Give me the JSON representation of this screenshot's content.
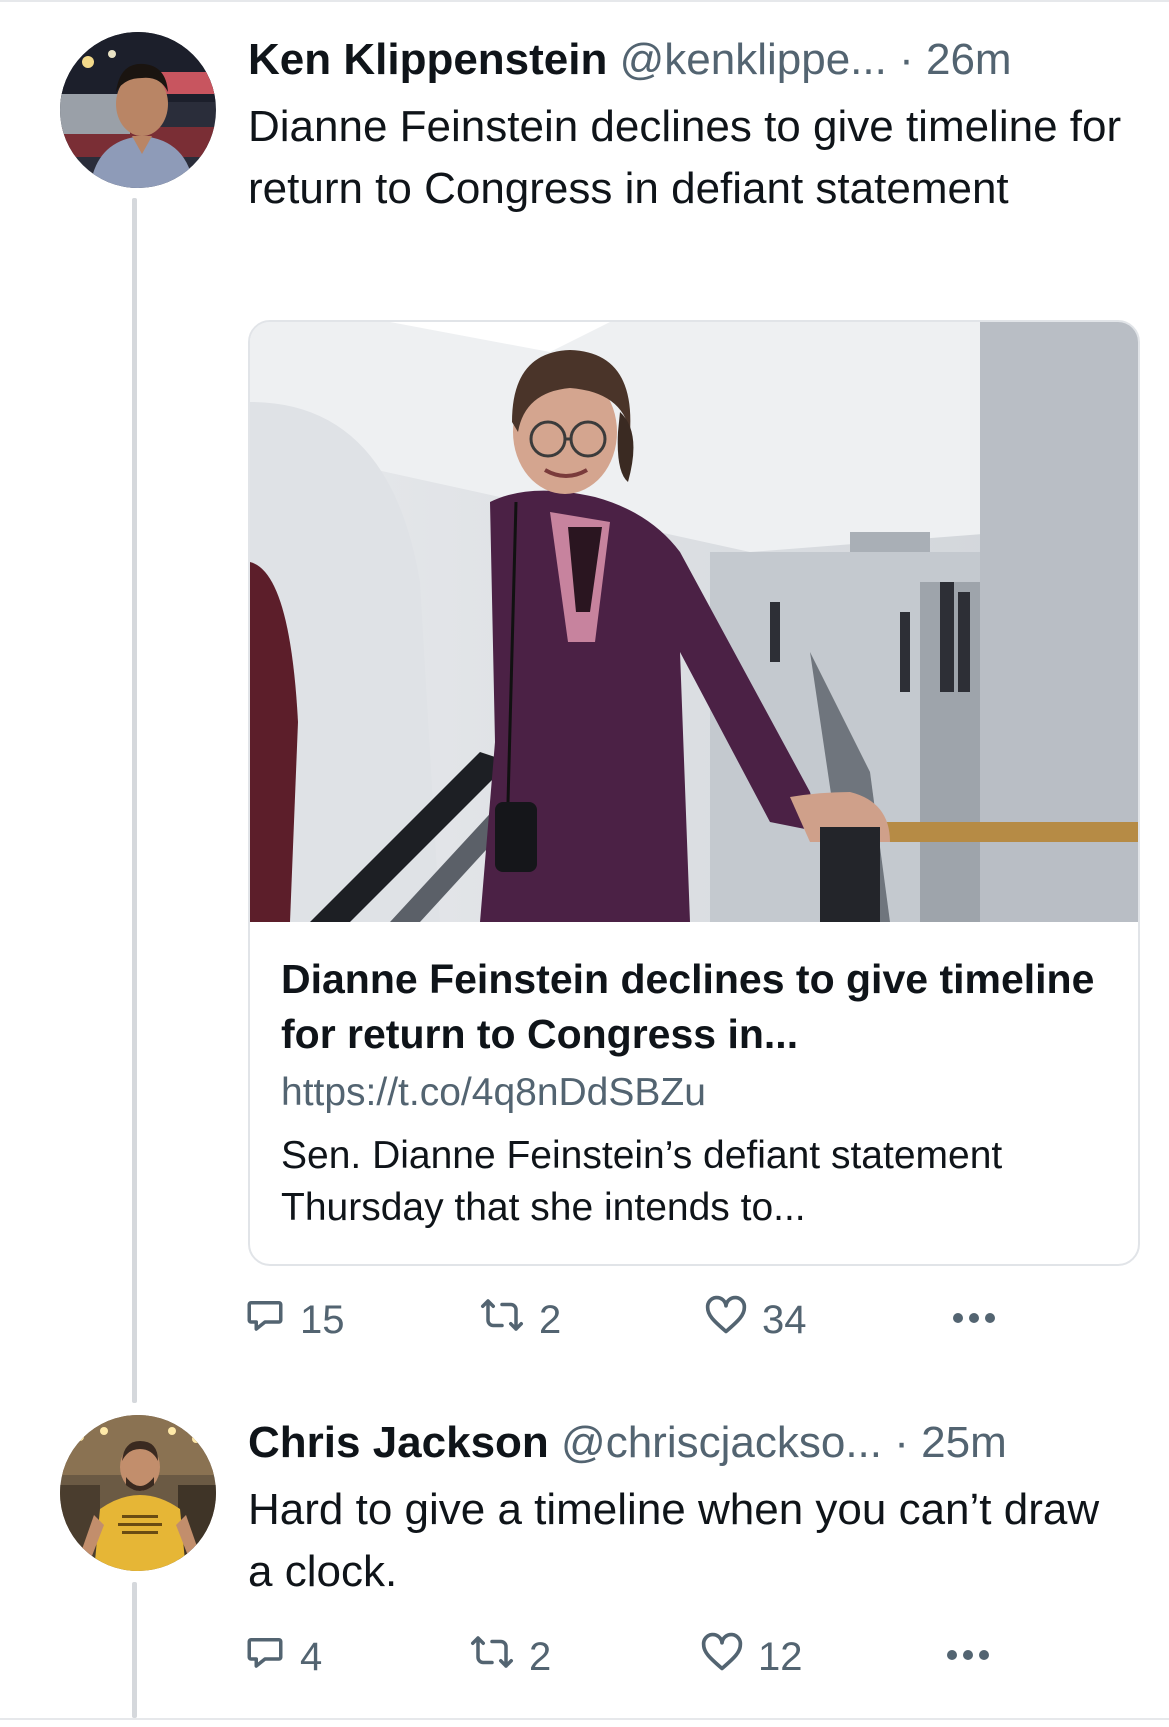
{
  "tweets": [
    {
      "name": "Ken Klippenstein",
      "handle": "@kenklippe...",
      "separator": "·",
      "time": "26m",
      "text": "Dianne Feinstein declines to give timeline for return to Congress in defiant statement",
      "card": {
        "title": "Dianne Feinstein declines to give timeline for return to Congress in...",
        "url": "https://t.co/4q8nDdSBZu",
        "description": "Sen. Dianne Feinstein’s defiant statement Thursday that she intends to..."
      },
      "actions": {
        "replies": "15",
        "retweets": "2",
        "likes": "34"
      }
    },
    {
      "name": "Chris Jackson",
      "handle": "@chriscjackso...",
      "separator": "·",
      "time": "25m",
      "text": "Hard to give a timeline when you can’t draw a clock.",
      "actions": {
        "replies": "4",
        "retweets": "2",
        "likes": "12"
      }
    }
  ],
  "icons": {
    "reply": "speech-bubble-icon",
    "retweet": "retweet-arrows-icon",
    "like": "heart-icon",
    "more": "more-dots-icon"
  },
  "colors": {
    "text": "#0f1419",
    "secondary": "#536471",
    "border": "#e1e4e8",
    "thread_line": "#d5d8dc"
  }
}
